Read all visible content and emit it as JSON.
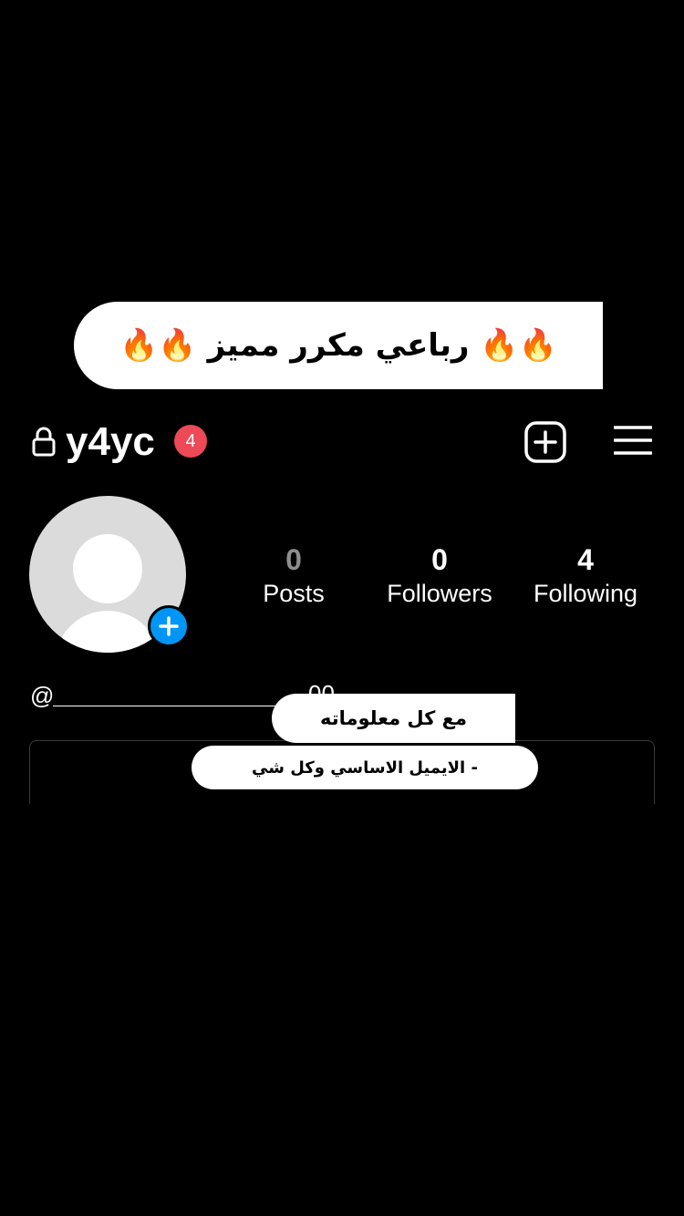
{
  "caption": {
    "text": "🔥🔥 رباعي مكرر مميز 🔥🔥"
  },
  "header": {
    "username": "y4yc",
    "notification_count": "4"
  },
  "profile": {
    "stats": [
      {
        "value": "0",
        "label": "Posts"
      },
      {
        "value": "0",
        "label": "Followers"
      },
      {
        "value": "4",
        "label": "Following"
      }
    ],
    "bio_handle_prefix": "@",
    "bio_handle_tail": "00"
  },
  "stickers": {
    "info": "مع كل معلوماته",
    "email": "- الايميل الاساسي وكل شي"
  },
  "colors": {
    "background": "#000000",
    "badge": "#ed4956",
    "accent_blue": "#0095f6",
    "avatar_gray": "#dbdbdb"
  },
  "icons": [
    "lock-icon",
    "add-post-icon",
    "menu-icon",
    "add-avatar-icon",
    "fire-icon"
  ]
}
